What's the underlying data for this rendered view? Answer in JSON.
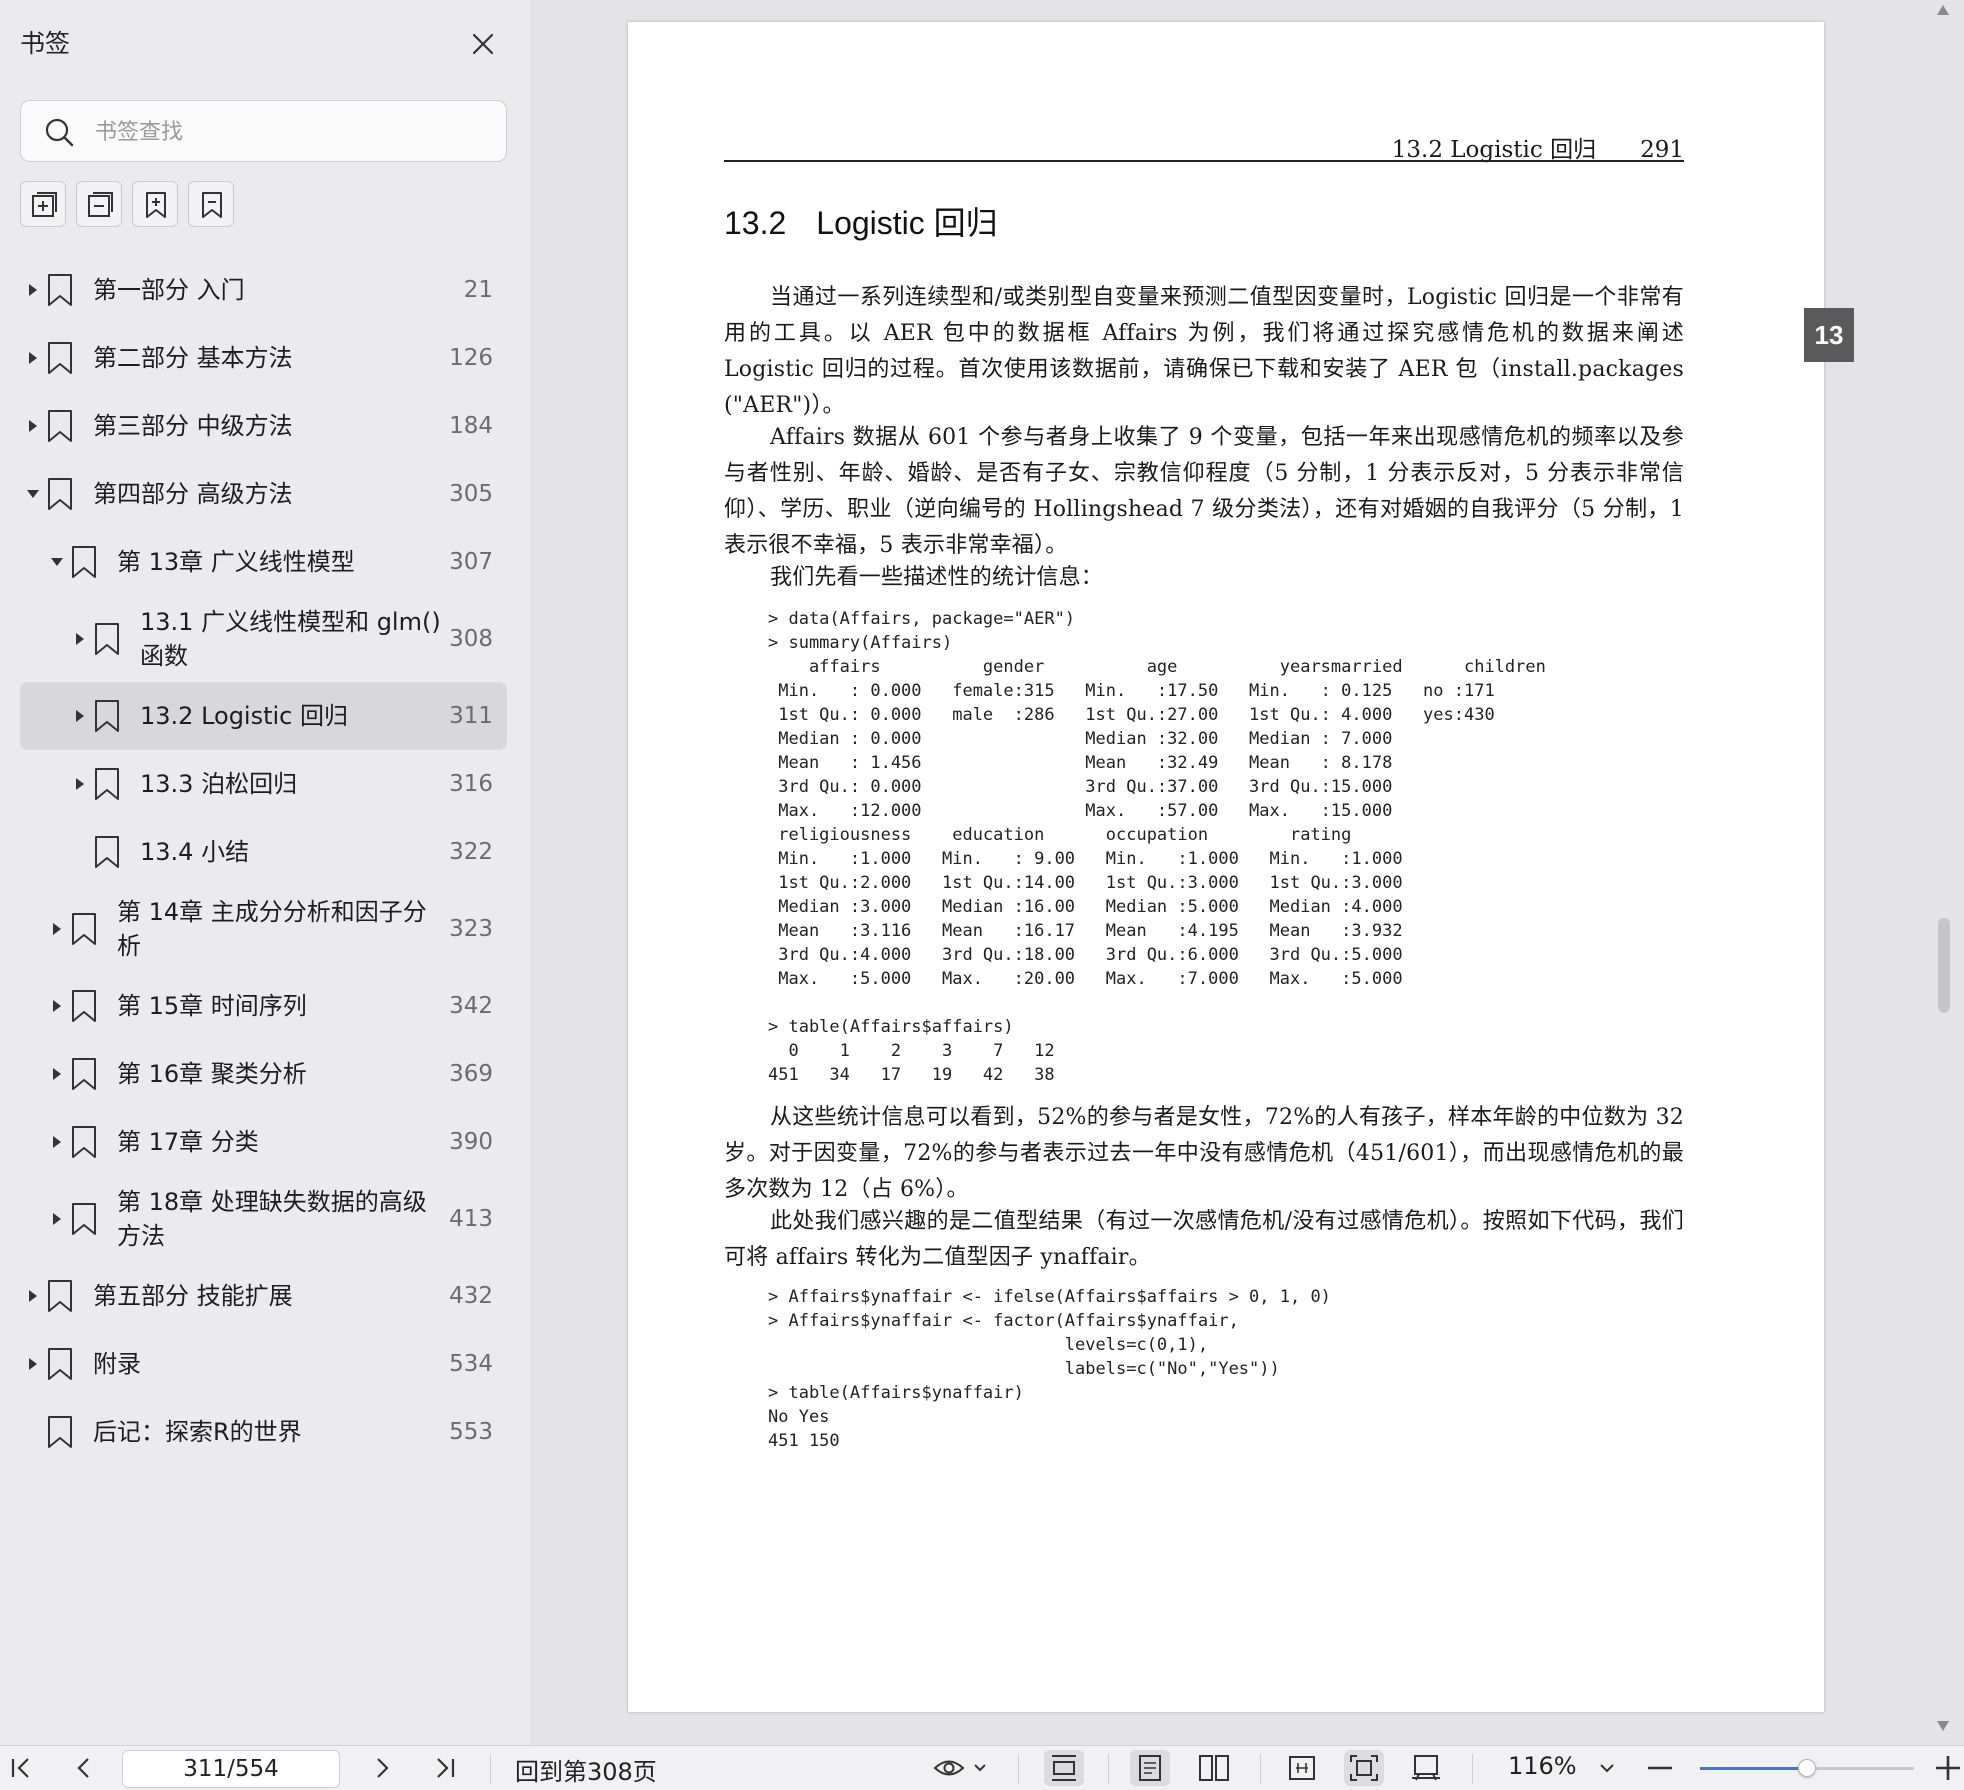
{
  "sidebar": {
    "title": "书签",
    "search_placeholder": "书签查找",
    "tools": [
      {
        "icon": "expand-all-icon"
      },
      {
        "icon": "collapse-all-icon"
      },
      {
        "icon": "add-bookmark-icon"
      },
      {
        "icon": "remove-bookmark-icon"
      }
    ],
    "items": [
      {
        "label": "第一部分  入门",
        "page": "21",
        "level": 0,
        "arrow": "right"
      },
      {
        "label": "第二部分  基本方法",
        "page": "126",
        "level": 0,
        "arrow": "right"
      },
      {
        "label": "第三部分  中级方法",
        "page": "184",
        "level": 0,
        "arrow": "right"
      },
      {
        "label": "第四部分  高级方法",
        "page": "305",
        "level": 0,
        "arrow": "down"
      },
      {
        "label": "第 13章  广义线性模型",
        "page": "307",
        "level": 1,
        "arrow": "down"
      },
      {
        "label": "13.1 广义线性模型和 glm()",
        "label2": "函数",
        "page": "308",
        "level": 2,
        "arrow": "right"
      },
      {
        "label": "13.2 Logistic 回归",
        "page": "311",
        "level": 2,
        "arrow": "right",
        "selected": true
      },
      {
        "label": "13.3 泊松回归",
        "page": "316",
        "level": 2,
        "arrow": "right"
      },
      {
        "label": "13.4 小结",
        "page": "322",
        "level": 2,
        "arrow": "none"
      },
      {
        "label": "第 14章  主成分分析和因子分",
        "label2": "析",
        "page": "323",
        "level": 1,
        "arrow": "right"
      },
      {
        "label": "第 15章  时间序列",
        "page": "342",
        "level": 1,
        "arrow": "right"
      },
      {
        "label": "第 16章  聚类分析",
        "page": "369",
        "level": 1,
        "arrow": "right"
      },
      {
        "label": "第 17章  分类",
        "page": "390",
        "level": 1,
        "arrow": "right"
      },
      {
        "label": "第 18章  处理缺失数据的高级",
        "label2": "方法",
        "page": "413",
        "level": 1,
        "arrow": "right"
      },
      {
        "label": "第五部分  技能扩展",
        "page": "432",
        "level": 0,
        "arrow": "right"
      },
      {
        "label": "附录",
        "page": "534",
        "level": 0,
        "arrow": "right"
      },
      {
        "label": "后记：探索R的世界",
        "page": "553",
        "level": 0,
        "arrow": "none"
      }
    ]
  },
  "document": {
    "running_head": "13.2   Logistic 回归",
    "page_number": "291",
    "section_number": "13.2",
    "section_title": "Logistic 回归",
    "thumb_tab": "13",
    "p1": "当通过一系列连续型和/或类别型自变量来预测二值型因变量时，Logistic 回归是一个非常有用的工具。以 AER 包中的数据框 Affairs 为例，我们将通过探究感情危机的数据来阐述 Logistic 回归的过程。首次使用该数据前，请确保已下载和安装了 AER 包（install.packages (\"AER\")）。",
    "p2": "Affairs 数据从 601 个参与者身上收集了 9 个变量，包括一年来出现感情危机的频率以及参与者性别、年龄、婚龄、是否有子女、宗教信仰程度（5 分制，1 分表示反对，5 分表示非常信仰）、学历、职业（逆向编号的 Hollingshead 7 级分类法），还有对婚姻的自我评分（5 分制，1 表示很不幸福，5 表示非常幸福）。",
    "p3": "我们先看一些描述性的统计信息：",
    "code1": "> data(Affairs, package=\"AER\")\n> summary(Affairs)\n    affairs          gender          age          yearsmarried      children\n Min.   : 0.000   female:315   Min.   :17.50   Min.   : 0.125   no :171\n 1st Qu.: 0.000   male  :286   1st Qu.:27.00   1st Qu.: 4.000   yes:430\n Median : 0.000                Median :32.00   Median : 7.000\n Mean   : 1.456                Mean   :32.49   Mean   : 8.178\n 3rd Qu.: 0.000                3rd Qu.:37.00   3rd Qu.:15.000\n Max.   :12.000                Max.   :57.00   Max.   :15.000\n religiousness    education      occupation        rating\n Min.   :1.000   Min.   : 9.00   Min.   :1.000   Min.   :1.000\n 1st Qu.:2.000   1st Qu.:14.00   1st Qu.:3.000   1st Qu.:3.000\n Median :3.000   Median :16.00   Median :5.000   Median :4.000\n Mean   :3.116   Mean   :16.17   Mean   :4.195   Mean   :3.932\n 3rd Qu.:4.000   3rd Qu.:18.00   3rd Qu.:6.000   3rd Qu.:5.000\n Max.   :5.000   Max.   :20.00   Max.   :7.000   Max.   :5.000\n\n> table(Affairs$affairs)\n  0    1    2    3    7   12\n451   34   17   19   42   38",
    "p4": "从这些统计信息可以看到，52%的参与者是女性，72%的人有孩子，样本年龄的中位数为 32 岁。对于因变量，72%的参与者表示过去一年中没有感情危机（451/601），而出现感情危机的最多次数为 12（占 6%）。",
    "p5": "此处我们感兴趣的是二值型结果（有过一次感情危机/没有过感情危机）。按照如下代码，我们可将 affairs 转化为二值型因子 ynaffair。",
    "code2": "> Affairs$ynaffair <- ifelse(Affairs$affairs > 0, 1, 0)\n> Affairs$ynaffair <- factor(Affairs$ynaffair,\n                             levels=c(0,1),\n                             labels=c(\"No\",\"Yes\"))\n> table(Affairs$ynaffair)\nNo Yes\n451 150"
  },
  "toolbar": {
    "page_indicator": "311/554",
    "back_link": "回到第308页",
    "zoom": "116%",
    "zoom_slider_fraction": 0.5,
    "accent_color": "#3a78e0"
  }
}
